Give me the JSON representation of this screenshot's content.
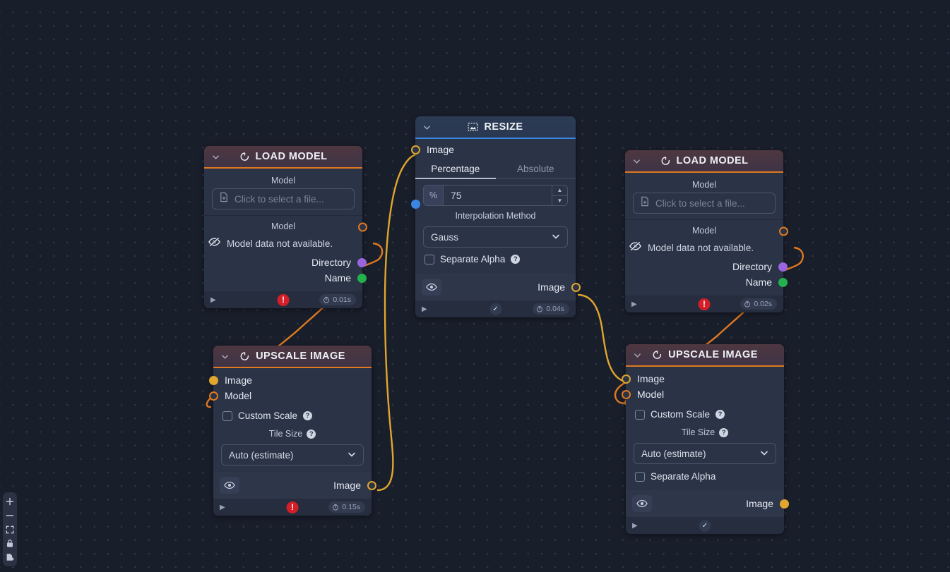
{
  "app": {
    "canvas_background": "#191e2b",
    "accent_orange": "#e0791f",
    "accent_amber": "#e0a62e",
    "accent_blue": "#3a86e0"
  },
  "toolbar": {
    "buttons": [
      {
        "name": "zoom-in",
        "glyph": "+"
      },
      {
        "name": "zoom-out",
        "glyph": "–"
      },
      {
        "name": "fit-to-screen",
        "glyph": "⛶"
      },
      {
        "name": "lock-workflow",
        "glyph": "🔒"
      },
      {
        "name": "export-template",
        "glyph": "🗎"
      }
    ]
  },
  "nodes": {
    "load_model_left": {
      "title": "LOAD MODEL",
      "icon": "spinner-icon",
      "collapse_icon": "chevron-down-icon",
      "field_label": "Model",
      "file_placeholder": "Click to select a file...",
      "file_icon": "file-add-icon",
      "output_group_label": "Model",
      "unavailable_text": "Model data not available.",
      "unavailable_icon": "eye-off-icon",
      "outputs": [
        {
          "label": "Model",
          "port": "ring-orange"
        },
        {
          "label": "Directory",
          "port": "filled-purple"
        },
        {
          "label": "Name",
          "port": "filled-green"
        }
      ],
      "footer": {
        "play_icon": "play-icon",
        "status": "error",
        "status_icon": "error-icon",
        "time": "0.01s",
        "time_icon": "timer-icon"
      }
    },
    "load_model_right": {
      "title": "LOAD MODEL",
      "icon": "spinner-icon",
      "collapse_icon": "chevron-down-icon",
      "field_label": "Model",
      "file_placeholder": "Click to select a file...",
      "file_icon": "file-add-icon",
      "output_group_label": "Model",
      "unavailable_text": "Model data not available.",
      "unavailable_icon": "eye-off-icon",
      "outputs": [
        {
          "label": "Model",
          "port": "ring-orange"
        },
        {
          "label": "Directory",
          "port": "filled-purple"
        },
        {
          "label": "Name",
          "port": "filled-green"
        }
      ],
      "footer": {
        "play_icon": "play-icon",
        "status": "error",
        "status_icon": "error-icon",
        "time": "0.02s",
        "time_icon": "timer-icon"
      }
    },
    "resize": {
      "title": "RESIZE",
      "icon": "resize-image-icon",
      "collapse_icon": "chevron-down-icon",
      "input_label": "Image",
      "tabs": [
        {
          "label": "Percentage",
          "active": true
        },
        {
          "label": "Absolute",
          "active": false
        }
      ],
      "percent_unit": "%",
      "percent_value": "75",
      "stepper_up_icon": "caret-up-icon",
      "stepper_down_icon": "caret-down-icon",
      "interp_label": "Interpolation Method",
      "interp_value": "Gauss",
      "interp_chevron": "chevron-down-icon",
      "separate_alpha_label": "Separate Alpha",
      "separate_alpha_checked": false,
      "separate_alpha_help": "help-icon",
      "preview_icon": "eye-icon",
      "output_label": "Image",
      "footer": {
        "play_icon": "play-icon",
        "status": "ok",
        "status_icon": "check-icon",
        "time": "0.04s",
        "time_icon": "timer-icon"
      }
    },
    "upscale_left": {
      "title": "UPSCALE IMAGE",
      "icon": "spinner-icon",
      "collapse_icon": "chevron-down-icon",
      "inputs": [
        {
          "label": "Image",
          "port": "filled-amber"
        },
        {
          "label": "Model",
          "port": "ring-orange"
        }
      ],
      "custom_scale_label": "Custom Scale",
      "custom_scale_checked": false,
      "custom_scale_help": "help-icon",
      "tile_size_label": "Tile Size",
      "tile_size_help": "help-icon",
      "tile_size_value": "Auto (estimate)",
      "tile_chevron": "chevron-down-icon",
      "preview_icon": "eye-icon",
      "output_label": "Image",
      "footer": {
        "play_icon": "play-icon",
        "status": "error",
        "status_icon": "error-icon",
        "time": "0.15s",
        "time_icon": "timer-icon"
      }
    },
    "upscale_right": {
      "title": "UPSCALE IMAGE",
      "icon": "spinner-icon",
      "collapse_icon": "chevron-down-icon",
      "inputs": [
        {
          "label": "Image",
          "port": "ring-amber"
        },
        {
          "label": "Model",
          "port": "ring-orange"
        }
      ],
      "custom_scale_label": "Custom Scale",
      "custom_scale_checked": false,
      "custom_scale_help": "help-icon",
      "tile_size_label": "Tile Size",
      "tile_size_help": "help-icon",
      "tile_size_value": "Auto (estimate)",
      "tile_chevron": "chevron-down-icon",
      "separate_alpha_label": "Separate Alpha",
      "separate_alpha_checked": false,
      "preview_icon": "eye-icon",
      "output_label": "Image",
      "footer": {
        "play_icon": "play-icon",
        "status": "ok",
        "status_icon": "check-icon"
      }
    }
  }
}
